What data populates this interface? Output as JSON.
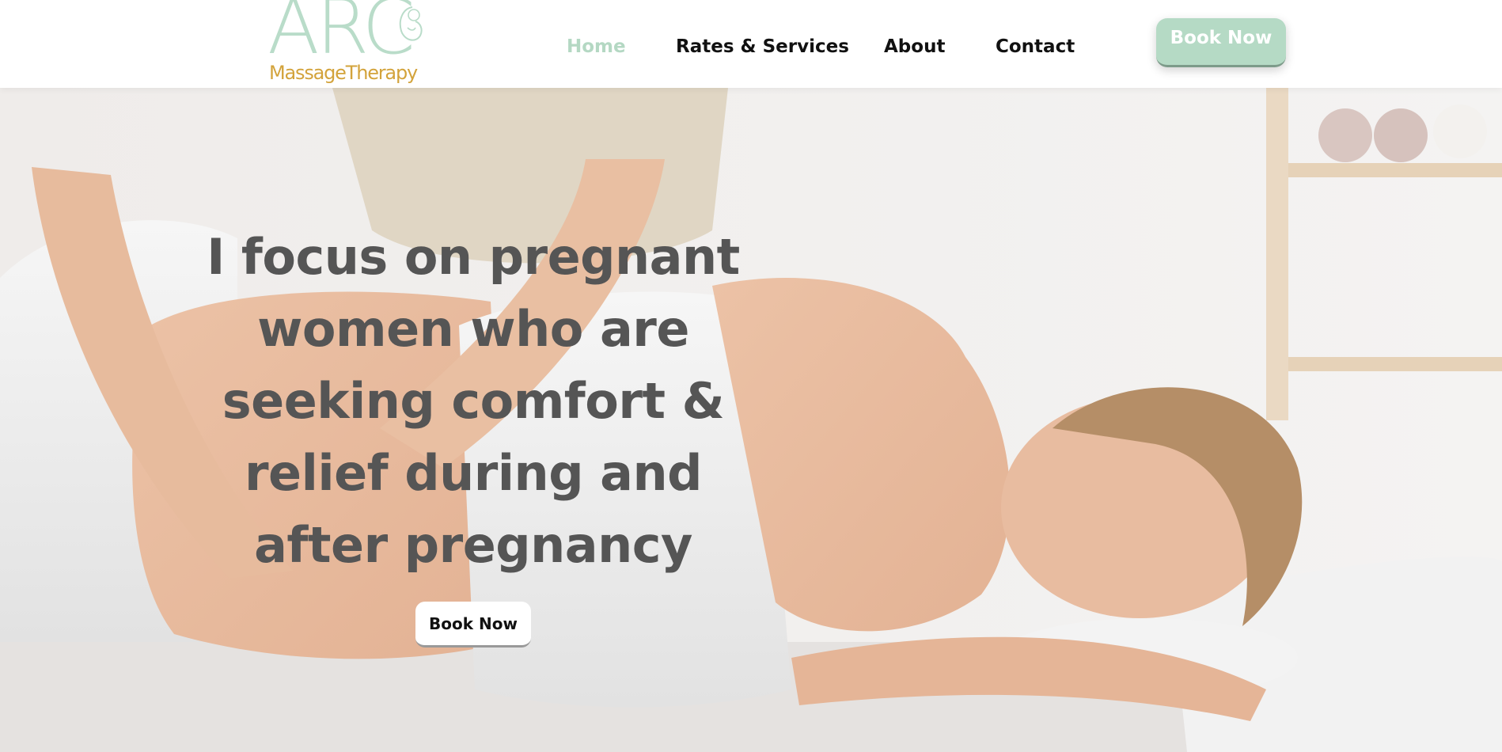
{
  "brand": {
    "logo_main": "ARC",
    "logo_sub": "MassageTherapy"
  },
  "nav": {
    "items": [
      {
        "label": "Home",
        "active": true
      },
      {
        "label": "Rates & Services",
        "active": false
      },
      {
        "label": "About",
        "active": false
      },
      {
        "label": "Contact",
        "active": false
      }
    ]
  },
  "header": {
    "cta_label": "Book Now"
  },
  "hero": {
    "headline": "I focus on pregnant women who are seeking comfort & relief during and after pregnancy",
    "cta_label": "Book Now"
  },
  "colors": {
    "accent_green": "#b5dac5",
    "logo_gold": "#d3a33b",
    "headline_gray": "#555555"
  }
}
